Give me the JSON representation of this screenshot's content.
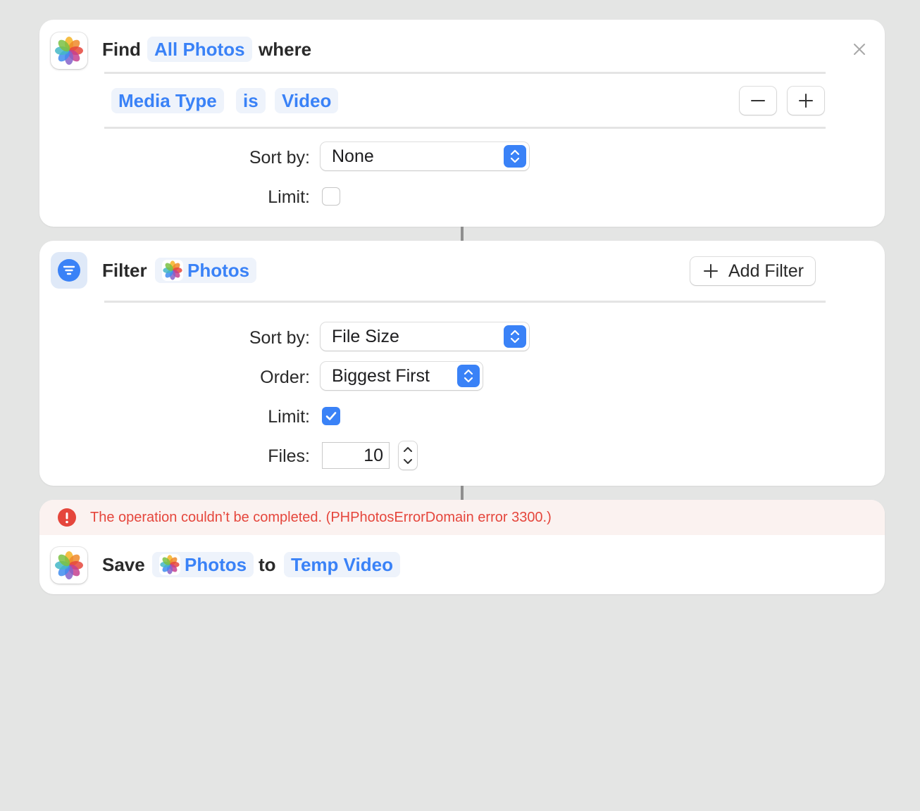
{
  "find_action": {
    "verb": "Find",
    "source_token": "All Photos",
    "conjunction": "where",
    "condition": {
      "field": "Media Type",
      "operator": "is",
      "value": "Video"
    },
    "sort_by": {
      "label": "Sort by:",
      "value": "None"
    },
    "limit": {
      "label": "Limit:",
      "checked": false
    },
    "icons": {
      "app": "photos-icon",
      "close": "close-icon",
      "remove": "minus-icon",
      "add": "plus-icon"
    }
  },
  "filter_action": {
    "verb": "Filter",
    "input_token": "Photos",
    "add_filter_label": "Add Filter",
    "sort_by": {
      "label": "Sort by:",
      "value": "File Size"
    },
    "order": {
      "label": "Order:",
      "value": "Biggest First"
    },
    "limit": {
      "label": "Limit:",
      "checked": true
    },
    "files": {
      "label": "Files:",
      "value": "10"
    },
    "icons": {
      "action": "filter-icon"
    }
  },
  "save_action": {
    "error_message": "The operation couldn’t be completed. (PHPhotosErrorDomain error 3300.)",
    "verb": "Save",
    "input_token": "Photos",
    "preposition": "to",
    "destination_token": "Temp Video",
    "icons": {
      "app": "photos-icon",
      "error": "exclamation-icon"
    }
  },
  "colors": {
    "accent": "#3a82f7",
    "token_bg": "#eef3fb",
    "error": "#e5463c",
    "error_bg": "#fbf2f0",
    "window_bg": "#e4e5e4"
  }
}
